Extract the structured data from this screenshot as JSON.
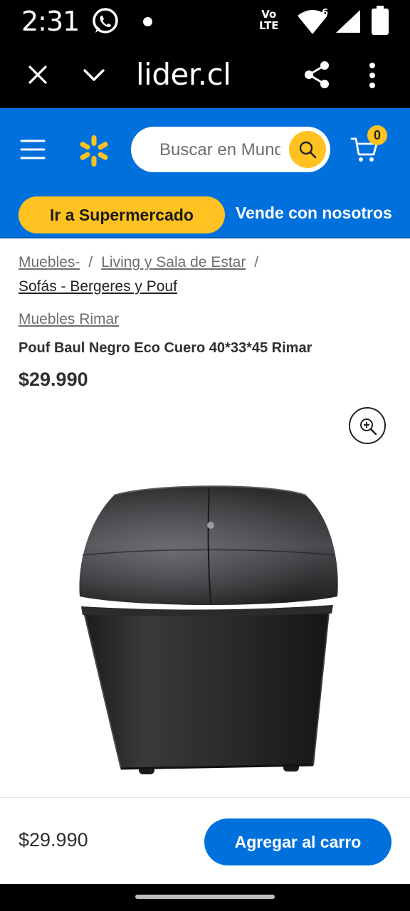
{
  "status_bar": {
    "time": "2:31",
    "network_line1": "Vo",
    "network_line2": "LTE",
    "signal_badge": "6"
  },
  "browser": {
    "url": "lider.cl"
  },
  "header": {
    "search_placeholder": "Buscar en Mundo Lider",
    "cart_count": "0",
    "brand_blue": "#0071dc",
    "accent_yellow": "#ffc220"
  },
  "sub_nav": {
    "supermarket_label": "Ir a Supermercado",
    "sell_label": "Vende con nosotros"
  },
  "breadcrumb": {
    "items": [
      "Muebles-",
      "Living y Sala de Estar",
      "Sofás - Bergeres y Pouf"
    ],
    "separator": "/"
  },
  "product": {
    "brand": "Muebles Rimar",
    "title": "Pouf Baul Negro Eco Cuero 40*33*45 Rimar",
    "price": "$29.990"
  },
  "bottom_bar": {
    "price": "$29.990",
    "add_to_cart_label": "Agregar al carro"
  },
  "icons": {
    "status": [
      "whatsapp-icon",
      "wifi-icon",
      "signal-icon",
      "battery-icon"
    ],
    "browser": [
      "close-icon",
      "chevron-down-icon",
      "share-icon",
      "more-vert-icon"
    ],
    "header": [
      "menu-icon",
      "spark-logo",
      "search-icon",
      "cart-icon"
    ],
    "product": [
      "zoom-in-icon"
    ]
  }
}
